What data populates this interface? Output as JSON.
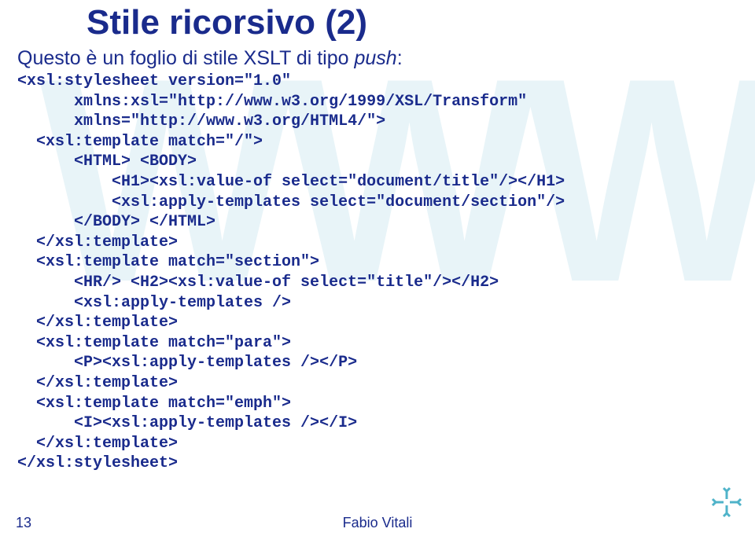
{
  "watermark": "WWW",
  "title": "Stile ricorsivo (2)",
  "subtitle_plain": "Questo è un foglio di stile XSLT di tipo ",
  "subtitle_italic": "push",
  "subtitle_colon": ":",
  "code": "<xsl:stylesheet version=\"1.0\"\n      xmlns:xsl=\"http://www.w3.org/1999/XSL/Transform\"\n      xmlns=\"http://www.w3.org/HTML4/\">\n  <xsl:template match=\"/\">\n      <HTML> <BODY>\n          <H1><xsl:value-of select=\"document/title\"/></H1>\n          <xsl:apply-templates select=\"document/section\"/>\n      </BODY> </HTML>\n  </xsl:template>\n  <xsl:template match=\"section\">\n      <HR/> <H2><xsl:value-of select=\"title\"/></H2>\n      <xsl:apply-templates />\n  </xsl:template>\n  <xsl:template match=\"para\">\n      <P><xsl:apply-templates /></P>\n  </xsl:template>\n  <xsl:template match=\"emph\">\n      <I><xsl:apply-templates /></I>\n  </xsl:template>\n</xsl:stylesheet>",
  "page_number": "13",
  "author": "Fabio Vitali"
}
